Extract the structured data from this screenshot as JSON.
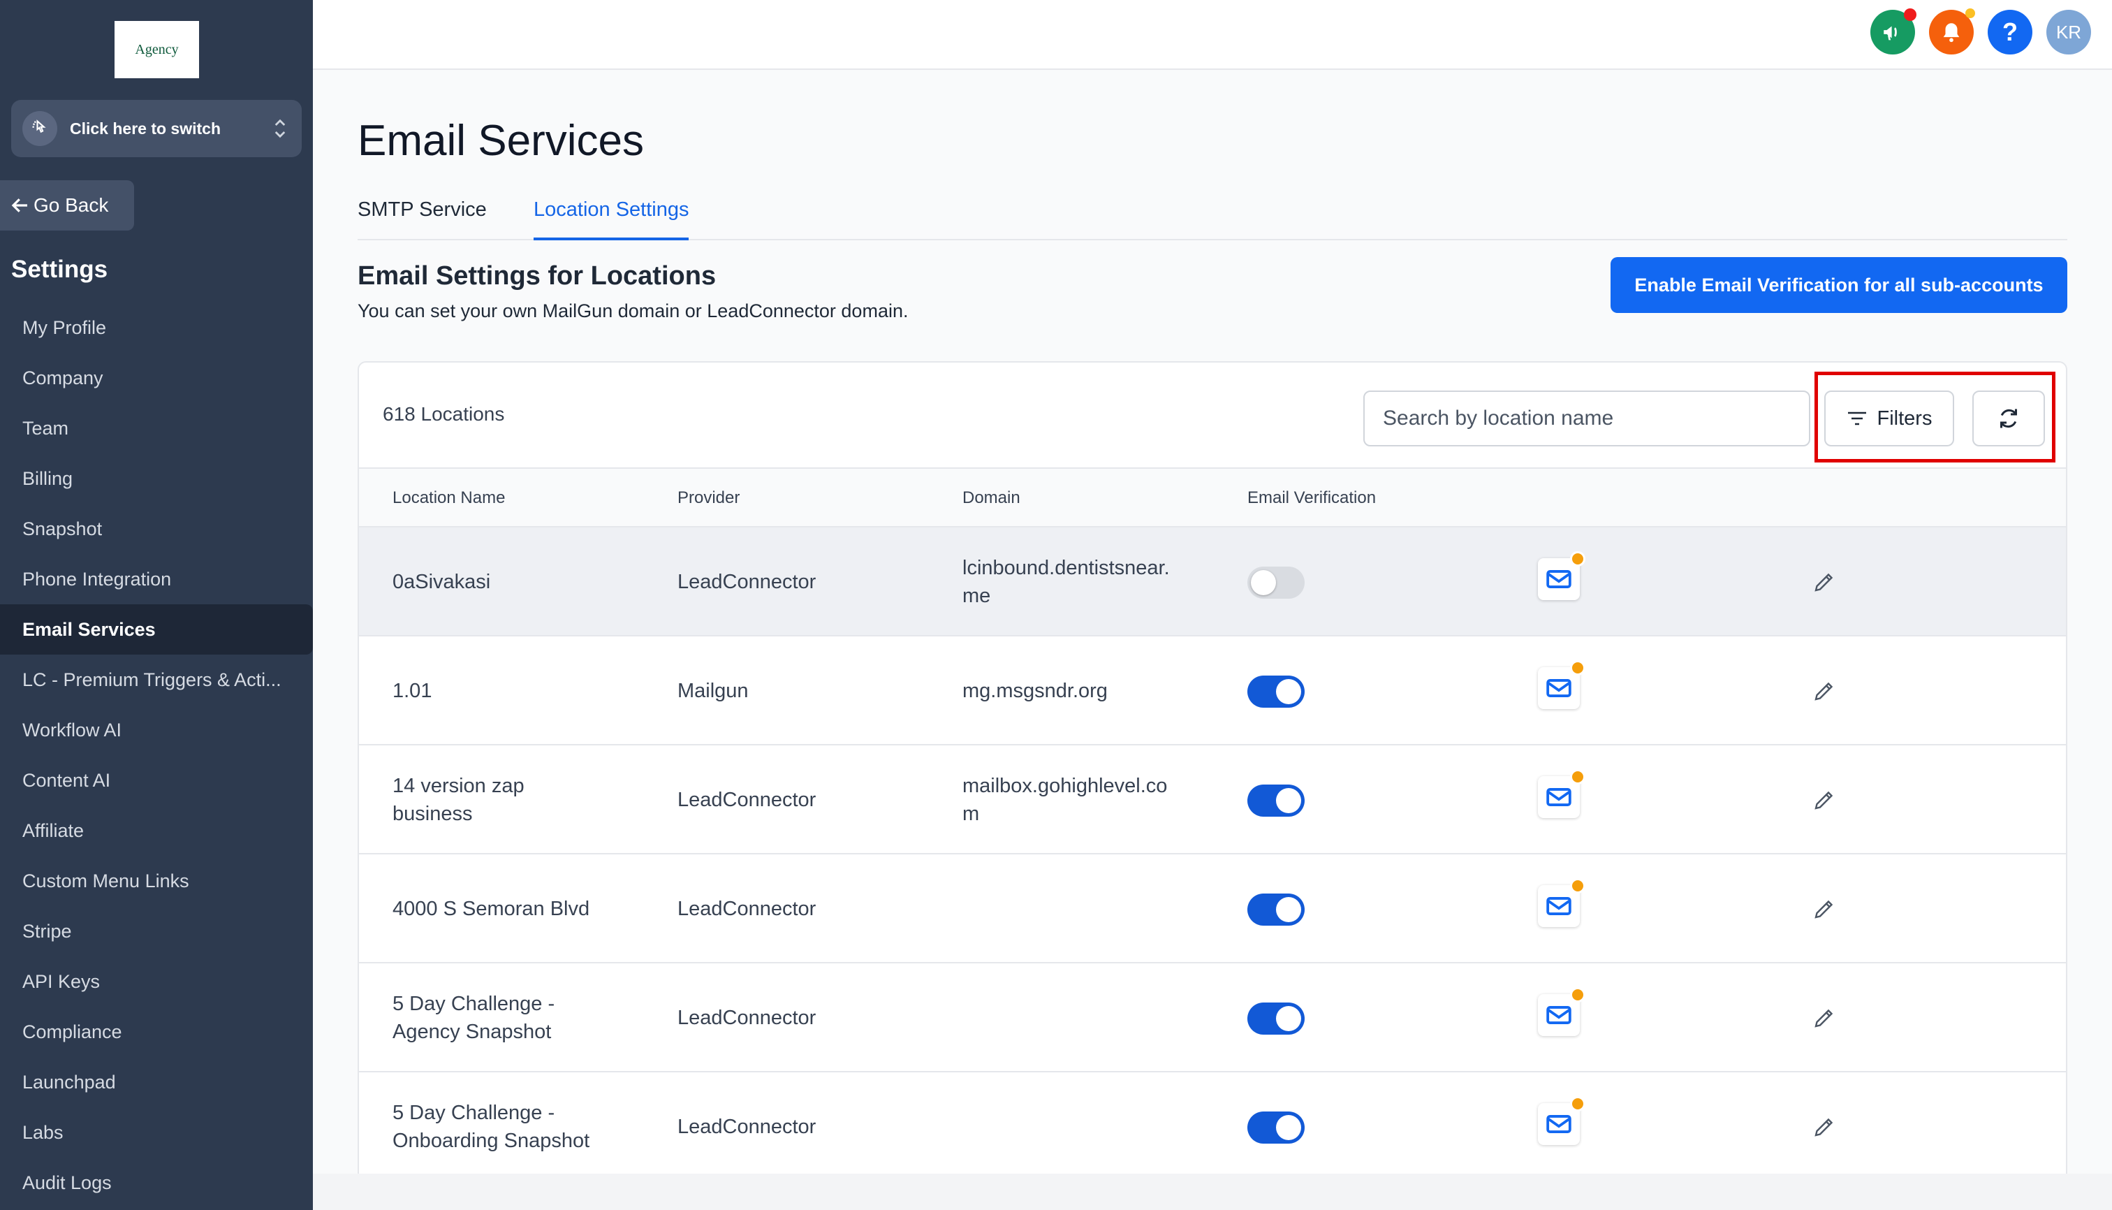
{
  "sidebar": {
    "logo_text": "Agency",
    "switcher_label": "Click here to switch",
    "go_back_label": "Go Back",
    "settings_heading": "Settings",
    "items": [
      {
        "label": "My Profile",
        "active": false
      },
      {
        "label": "Company",
        "active": false
      },
      {
        "label": "Team",
        "active": false
      },
      {
        "label": "Billing",
        "active": false
      },
      {
        "label": "Snapshot",
        "active": false
      },
      {
        "label": "Phone Integration",
        "active": false
      },
      {
        "label": "Email Services",
        "active": true
      },
      {
        "label": "LC - Premium Triggers & Acti...",
        "active": false
      },
      {
        "label": "Workflow AI",
        "active": false
      },
      {
        "label": "Content AI",
        "active": false
      },
      {
        "label": "Affiliate",
        "active": false
      },
      {
        "label": "Custom Menu Links",
        "active": false
      },
      {
        "label": "Stripe",
        "active": false
      },
      {
        "label": "API Keys",
        "active": false
      },
      {
        "label": "Compliance",
        "active": false
      },
      {
        "label": "Launchpad",
        "active": false
      },
      {
        "label": "Labs",
        "active": false
      },
      {
        "label": "Audit Logs",
        "active": false
      }
    ]
  },
  "header": {
    "avatar_initials": "KR",
    "help_label": "?"
  },
  "main": {
    "title": "Email Services",
    "tabs": [
      {
        "label": "SMTP Service",
        "active": false
      },
      {
        "label": "Location Settings",
        "active": true
      }
    ],
    "section_title": "Email Settings for Locations",
    "section_subtitle": "You can set your own MailGun domain or LeadConnector domain.",
    "enable_button_label": "Enable Email Verification for all sub-accounts",
    "locations_count": "618 Locations",
    "search_placeholder": "Search by location name",
    "filters_label": "Filters",
    "table": {
      "columns": [
        "Location Name",
        "Provider",
        "Domain",
        "Email Verification"
      ],
      "rows": [
        {
          "name": "0aSivakasi",
          "provider": "LeadConnector",
          "domain": "lcinbound.dentistsnear.\nme",
          "verification": false
        },
        {
          "name": "1.01",
          "provider": "Mailgun",
          "domain": "mg.msgsndr.org",
          "verification": true
        },
        {
          "name": "14 version zap\nbusiness",
          "provider": "LeadConnector",
          "domain": "mailbox.gohighlevel.co\nm",
          "verification": true
        },
        {
          "name": "4000 S Semoran Blvd",
          "provider": "LeadConnector",
          "domain": "",
          "verification": true
        },
        {
          "name": "5 Day Challenge -\nAgency Snapshot",
          "provider": "LeadConnector",
          "domain": "",
          "verification": true
        },
        {
          "name": "5 Day Challenge -\nOnboarding Snapshot",
          "provider": "LeadConnector",
          "domain": "",
          "verification": true
        }
      ]
    }
  },
  "colors": {
    "sidebar_bg": "#2d3a4f",
    "accent": "#1268f2",
    "toggle_on": "#1259d6",
    "highlight": "#e00000"
  },
  "icons": [
    "megaphone-icon",
    "bell-icon",
    "help-icon",
    "mail-icon",
    "pencil-icon",
    "filter-icon",
    "refresh-icon",
    "arrow-left-icon",
    "switch-icon",
    "chevron-updown-icon"
  ]
}
